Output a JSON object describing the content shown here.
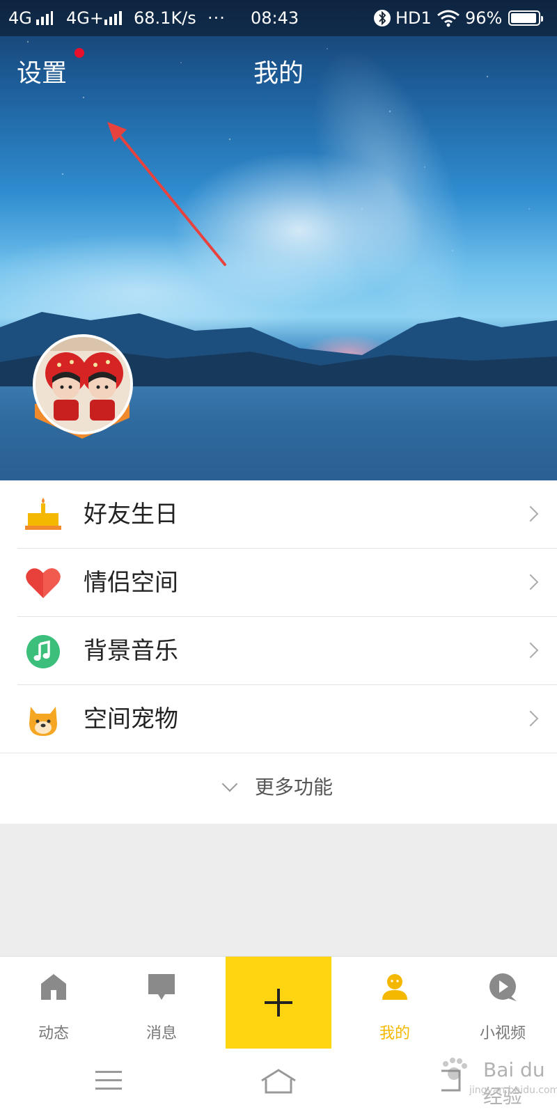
{
  "status_bar": {
    "signal1": "4G",
    "signal2": "4G+",
    "speed": "68.1K/s",
    "dots": "···",
    "time": "08:43",
    "hd": "HD1",
    "battery": "96%",
    "battery_level": 0.96
  },
  "header": {
    "settings_label": "设置",
    "title": "我的"
  },
  "menu": {
    "items": [
      {
        "label": "好友生日",
        "icon": "birthday-cake-icon"
      },
      {
        "label": "情侣空间",
        "icon": "heart-icon"
      },
      {
        "label": "背景音乐",
        "icon": "music-note-icon"
      },
      {
        "label": "空间宠物",
        "icon": "pet-dog-icon"
      }
    ],
    "more_label": "更多功能"
  },
  "tab_bar": {
    "tabs": [
      {
        "label": "动态",
        "icon": "home-icon",
        "active": false
      },
      {
        "label": "消息",
        "icon": "message-icon",
        "active": false
      },
      {
        "label": "",
        "icon": "plus-icon",
        "active": false
      },
      {
        "label": "我的",
        "icon": "profile-icon",
        "active": true
      },
      {
        "label": "小视频",
        "icon": "video-play-icon",
        "active": false
      }
    ],
    "active_color": "#f5b800",
    "plus_bg": "#ffd410"
  },
  "watermark": {
    "text": "Bai du 经验",
    "sub": "jingyan.baidu.com"
  }
}
